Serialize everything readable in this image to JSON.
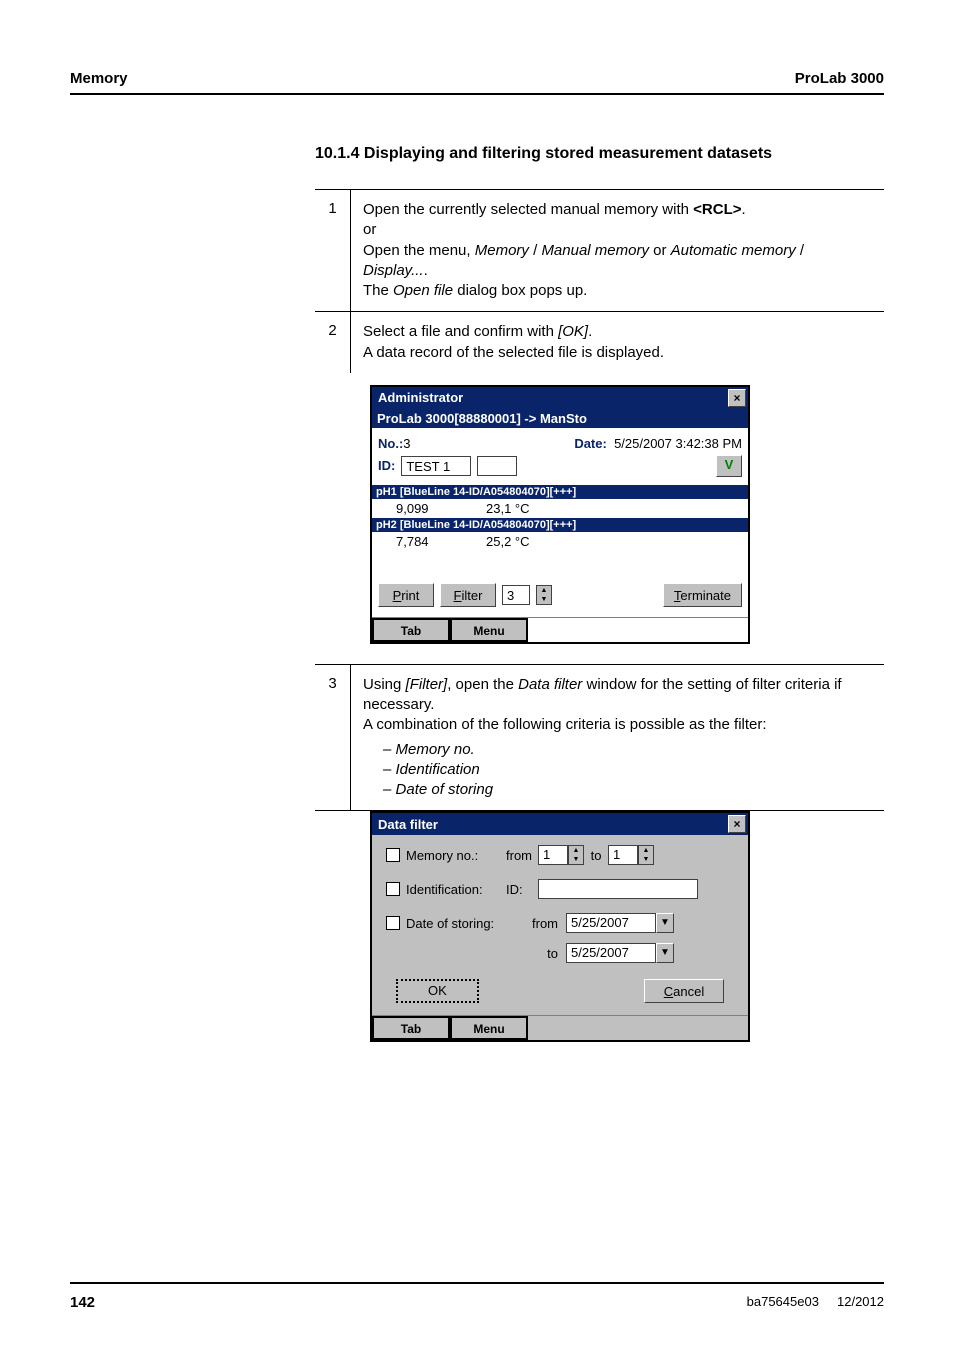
{
  "header": {
    "left": "Memory",
    "right": "ProLab 3000"
  },
  "section": {
    "title": "10.1.4  Displaying and filtering stored measurement datasets"
  },
  "steps": {
    "s1": {
      "num": "1",
      "l1a": "Open the currently selected manual memory with ",
      "rcl": "<RCL>",
      "l1b": ".",
      "or": "or",
      "l2a": "Open the menu, ",
      "m1": "Memory",
      "sep1": " / ",
      "m2": "Manual memory",
      "sep2": " or ",
      "m3": "Automatic memory",
      "sep3": " / ",
      "m4": "Display...",
      "dot": ".",
      "l3a": "The ",
      "of": "Open file",
      "l3b": " dialog box pops up."
    },
    "s2": {
      "num": "2",
      "l1a": "Select a file and confirm with ",
      "ok": "[OK]",
      "dot": ".",
      "l2": "A data record of the selected file is displayed."
    },
    "s3": {
      "num": "3",
      "l1a": "Using ",
      "flt": "[Filter]",
      "l1b": ", open the ",
      "df": "Data filter",
      "l1c": " window for the setting of filter criteria if necessary.",
      "l2": "A combination of the following criteria is possible as the filter:",
      "b1": "Memory no.",
      "b2": "Identification",
      "b3": "Date of storing"
    }
  },
  "dlg1": {
    "title": "Administrator",
    "close": "×",
    "sub": "ProLab 3000[88880001] -> ManSto",
    "no_label": "No.:",
    "no_val": "3",
    "date_label": "Date:",
    "date_val": "5/25/2007 3:42:38 PM",
    "id_label": "ID:",
    "id_val": "TEST 1",
    "vbtn": "V",
    "ph1_head": "pH1 [BlueLine 14-ID/A054804070][+++]",
    "ph1_v1": "9,099",
    "ph1_v2": "23,1 °C",
    "ph2_head": "pH2 [BlueLine 14-ID/A054804070][+++]",
    "ph2_v1": "7,784",
    "ph2_v2": "25,2 °C",
    "print_p": "P",
    "print_rest": "rint",
    "filter_f": "F",
    "filter_rest": "ilter",
    "spin_val": "3",
    "term_t": "T",
    "term_rest": "erminate",
    "tab": "Tab",
    "menu": "Menu"
  },
  "dlg2": {
    "title": "Data filter",
    "close": "×",
    "mem_lbl": "Memory no.:",
    "from": "from",
    "from_val": "1",
    "to": "to",
    "to_val": "1",
    "ident_lbl": "Identification:",
    "id_lbl": "ID:",
    "dos_lbl": "Date of storing:",
    "from2": "from",
    "date_from": "5/25/2007",
    "to2": "to",
    "date_to": "5/25/2007",
    "ok": "OK",
    "cancel_c": "C",
    "cancel_rest": "ancel",
    "tab": "Tab",
    "menu": "Menu"
  },
  "footer": {
    "page": "142",
    "doc": "ba75645e03",
    "date": "12/2012"
  }
}
